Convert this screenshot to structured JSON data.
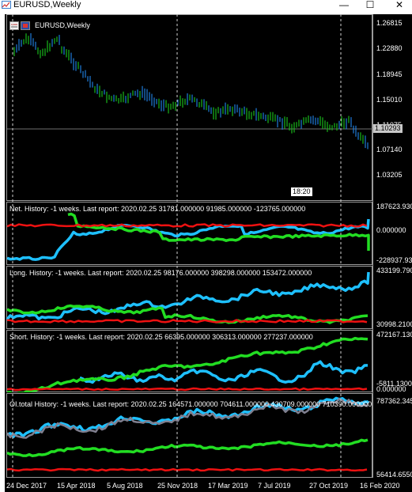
{
  "window": {
    "title": "EURUSD,Weekly",
    "controls": [
      "—",
      "☐",
      "✕"
    ]
  },
  "main_chart": {
    "label": "EURUSD,Weekly",
    "price_ticks": [
      "1.26815",
      "1.22880",
      "1.18945",
      "1.15010",
      "1.11075",
      "1.07140",
      "1.03205"
    ],
    "current_price": "1.10293",
    "time_marker": "18:20"
  },
  "indicators": [
    {
      "id": "net",
      "label": "Net. History: -1 weeks. Last report: 2020.02.25    31781.000000  91985.000000  -123765.000000",
      "ticks": [
        "187623.930",
        "0.000000",
        "-228937.930"
      ]
    },
    {
      "id": "long",
      "label": "Long. History: -1 weeks. Last report: 2020.02.25    98176.000000  398298.000000  153472.000000",
      "ticks": [
        "433199.790",
        "30998.2100"
      ]
    },
    {
      "id": "short",
      "label": "Short. History: -1 weeks. Last report: 2020.02.25    66395.000000  306313.000000  277237.000000",
      "ticks": [
        "472167.130",
        "-5811.1300",
        "0.000000"
      ]
    },
    {
      "id": "oi",
      "label": "OI.total History: -1 weeks. Last report: 2020.02.25    164571.000000  704611.000000  430709.000000  710390.000000",
      "ticks": [
        "787362.345",
        "56414.6550"
      ]
    }
  ],
  "x_axis": [
    "24 Dec 2017",
    "15 Apr 2018",
    "5 Aug 2018",
    "25 Nov 2018",
    "17 Mar 2019",
    "7 Jul 2019",
    "27 Oct 2019",
    "16 Feb 2020"
  ],
  "colors": {
    "background": "#000000",
    "grid": "#9a9a9a",
    "candles": "#1e7bd8",
    "candles_up": "#19b71a",
    "net": "#1ec0ff",
    "net2": "#22dd22",
    "net3": "#ee1111",
    "oi_gray": "#7f7f8f"
  }
}
